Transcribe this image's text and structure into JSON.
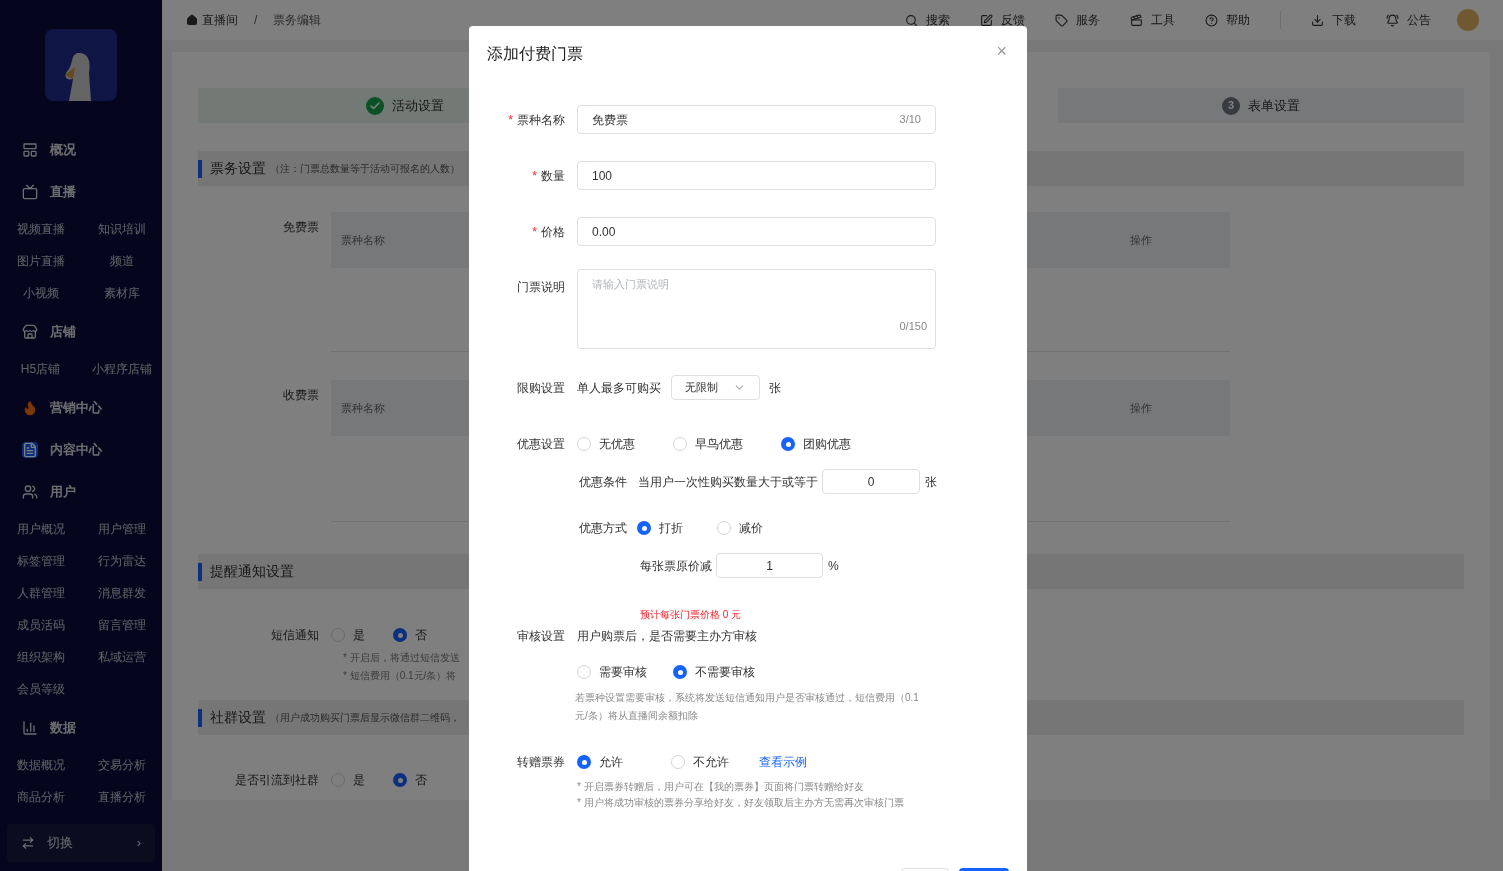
{
  "sidebar": {
    "sections": [
      {
        "label": "概况"
      },
      {
        "label": "直播",
        "children": [
          "视频直播",
          "知识培训",
          "图片直播",
          "频道",
          "小视频",
          "素材库"
        ]
      },
      {
        "label": "店铺",
        "children": [
          "H5店铺",
          "小程序店铺"
        ]
      },
      {
        "label": "营销中心"
      },
      {
        "label": "内容中心"
      },
      {
        "label": "用户",
        "children": [
          "用户概况",
          "用户管理",
          "标签管理",
          "行为雷达",
          "人群管理",
          "消息群发",
          "成员活码",
          "留言管理",
          "组织架构",
          "私域运营",
          "会员等级"
        ]
      },
      {
        "label": "数据",
        "children": [
          "数据概况",
          "交易分析",
          "商品分析",
          "直播分析"
        ]
      }
    ],
    "switch": {
      "label": "切换",
      "arrow": "›"
    }
  },
  "breadcrumb": [
    "直播间",
    "/",
    "票务编辑"
  ],
  "toolbar": [
    "搜索",
    "反馈",
    "服务",
    "工具",
    "帮助",
    "下载",
    "公告"
  ],
  "steps": [
    {
      "label": "活动设置"
    },
    {
      "number": "3",
      "label": "表单设置"
    }
  ],
  "ticket_section": {
    "title": "票务设置",
    "note": "（注：门票总数量等于活动可报名的人数）",
    "tables": [
      {
        "label": "免费票",
        "column_1": "票种名称",
        "column_2": "操作"
      },
      {
        "label": "收费票",
        "column_1": "票种名称",
        "column_2": "操作"
      }
    ]
  },
  "notify_section": {
    "title": "提醒通知设置",
    "label": "短信通知",
    "options": [
      {
        "label": "是",
        "selected": false
      },
      {
        "label": "否",
        "selected": true
      }
    ],
    "notes": [
      "* 开启后，将通过短信发送",
      "* 短信费用（0.1元/条）将"
    ]
  },
  "group_section": {
    "title": "社群设置",
    "note": "（用户成功购买门票后显示微信群二维码，",
    "label": "是否引流到社群",
    "options": [
      {
        "label": "是",
        "selected": false
      },
      {
        "label": "否",
        "selected": true
      }
    ]
  },
  "dialog": {
    "title": "添加付费门票",
    "close": "×",
    "name": {
      "label": "票种名称",
      "required_mark": "*",
      "value": "免费票",
      "count": "3/10"
    },
    "quantity": {
      "label": "数量",
      "required_mark": "*",
      "value": "100"
    },
    "price": {
      "label": "价格",
      "required_mark": "*",
      "value": "0.00"
    },
    "description": {
      "label": "门票说明",
      "placeholder": "请输入门票说明",
      "count": "0/150"
    },
    "limit": {
      "label": "限购设置",
      "text": "单人最多可购买",
      "value": "无限制",
      "unit": "张"
    },
    "discount": {
      "label": "优惠设置",
      "options": [
        {
          "label": "无优惠",
          "selected": false
        },
        {
          "label": "早鸟优惠",
          "selected": false
        },
        {
          "label": "团购优惠",
          "selected": true
        }
      ],
      "condition": {
        "label": "优惠条件",
        "text": "当用户一次性购买数量大于或等于",
        "value": "0",
        "unit": "张"
      },
      "mode": {
        "label": "优惠方式",
        "options": [
          {
            "label": "打折",
            "selected": true
          },
          {
            "label": "减价",
            "selected": false
          }
        ]
      },
      "reduce": {
        "label": "每张票原价减",
        "value": "1",
        "unit": "%"
      },
      "estimate": "预计每张门票价格 0 元"
    },
    "review": {
      "label": "审核设置",
      "question": "用户购票后，是否需要主办方审核",
      "options": [
        {
          "label": "需要审核",
          "selected": false
        },
        {
          "label": "不需要审核",
          "selected": true
        }
      ],
      "note": "若票种设置需要审核，系统将发送短信通知用户是否审核通过，短信费用（0.1元/条）将从直播间余额扣除"
    },
    "transfer": {
      "label": "转赠票券",
      "options": [
        {
          "label": "允许",
          "selected": true
        },
        {
          "label": "不允许",
          "selected": false
        }
      ],
      "link": "查看示例",
      "notes": [
        "* 开启票券转赠后，用户可在【我的票券】页面将门票转赠给好友",
        "* 用户将成功审核的票券分享给好友，好友领取后主办方无需再次审核门票"
      ]
    }
  }
}
